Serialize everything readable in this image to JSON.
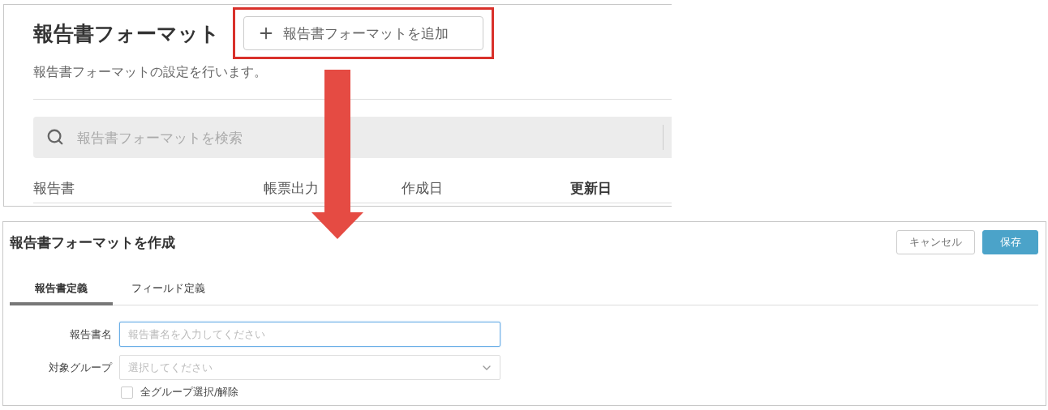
{
  "list_screen": {
    "title": "報告書フォーマット",
    "add_button": {
      "label": "報告書フォーマットを追加",
      "highlighted": true
    },
    "description": "報告書フォーマットの設定を行います。",
    "search": {
      "placeholder": "報告書フォーマットを検索"
    },
    "columns": [
      {
        "label": "報告書",
        "sorted": false
      },
      {
        "label": "帳票出力",
        "sorted": false
      },
      {
        "label": "作成日",
        "sorted": false
      },
      {
        "label": "更新日",
        "sorted": true
      }
    ]
  },
  "create_screen": {
    "title": "報告書フォーマットを作成",
    "buttons": [
      {
        "label": "キャンセル",
        "kind": "secondary"
      },
      {
        "label": "保存",
        "kind": "primary"
      }
    ],
    "tabs": [
      {
        "label": "報告書定義",
        "selected": true
      },
      {
        "label": "フィールド定義",
        "selected": false
      }
    ],
    "fields": [
      {
        "kind": "text",
        "label": "報告書名",
        "placeholder": "報告書名を入力してください",
        "focused": true
      },
      {
        "kind": "select",
        "label": "対象グループ",
        "placeholder": "選択してください",
        "focused": false
      }
    ],
    "checkbox": {
      "label": "全グループ選択/解除",
      "checked": false
    }
  }
}
